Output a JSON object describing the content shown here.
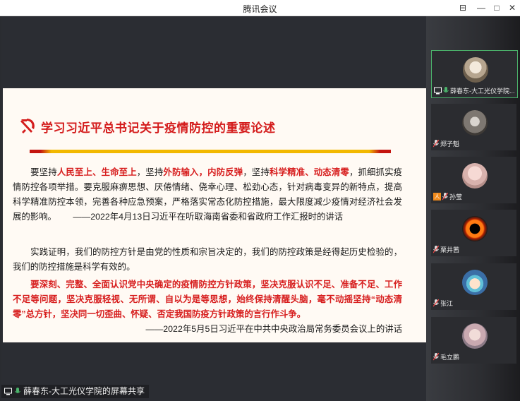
{
  "window": {
    "title": "腾讯会议",
    "buttons": {
      "pin": "⊟",
      "minimize": "—",
      "maximize": "□",
      "close": "✕"
    }
  },
  "slide": {
    "title": "学习习近平总书记关于疫情防控的重要论述",
    "p1": {
      "t1": "要坚持",
      "r1": "人民至上、生命至上",
      "t2": "，坚持",
      "r2": "外防输入，内防反弹",
      "t3": "，坚持",
      "r3": "科学精准、动态清零",
      "t4": "，抓细抓实疫情防控各项举措。要克服麻痹思想、厌倦情绪、侥幸心理、松劲心态，针对病毒变异的新特点，提高科学精准防控本领，完善各种应急预案，严格落实常态化防控措施，最大限度减少疫情对经济社会发展的影响。",
      "source": "——2022年4月13日习近平在听取海南省委和省政府工作汇报时的讲话"
    },
    "p2": "实践证明，我们的防控方针是由党的性质和宗旨决定的，我们的防控政策是经得起历史检验的，我们的防控措施是科学有效的。",
    "p3": {
      "red": "要深刻、完整、全面认识党中央确定的疫情防控方针政策，坚决克服认识不足、准备不足、工作不足等问题，坚决克服轻视、无所谓、自以为是等思想，始终保持清醒头脑，毫不动摇坚持“动态清零”总方针，坚决同一切歪曲、怀疑、否定我国防疫方针政策的言行作斗争。",
      "source": "——2022年5月5日习近平在中共中央政治局常务委员会议上的讲话"
    }
  },
  "share_label": "薛春东-大工光仪学院的屏幕共享",
  "participants": [
    {
      "name": "薛春东-大工光仪学院...",
      "avatar": "photo-avatar",
      "active": true
    },
    {
      "name": "郑子魁",
      "avatar": "photo-avatar"
    },
    {
      "name": "孙莹",
      "avatar": "photo-avatar"
    },
    {
      "name": "栗井茜",
      "avatar": "blackhole-avatar"
    },
    {
      "name": "张江",
      "avatar": "cartoon-avatar"
    },
    {
      "name": "毛立鹏",
      "avatar": "photo-avatar"
    }
  ],
  "colors": {
    "accent_red": "#d71e1e",
    "rule_gold": "#f2b800",
    "active_border": "#4bb36b"
  }
}
